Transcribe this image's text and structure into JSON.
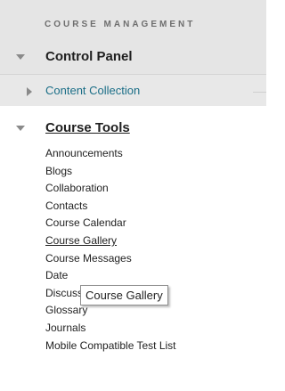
{
  "section_heading": "COURSE MANAGEMENT",
  "control_panel": {
    "title": "Control Panel",
    "content_collection": "Content Collection"
  },
  "course_tools": {
    "title": "Course Tools",
    "items": [
      "Announcements",
      "Blogs",
      "Collaboration",
      "Contacts",
      "Course Calendar",
      "Course Gallery",
      "Course Messages",
      "Date",
      "Discussion Board",
      "Glossary",
      "Journals",
      "Mobile Compatible Test List"
    ],
    "hovered_item": "Course Gallery"
  },
  "tooltip": "Course Gallery",
  "icons": {
    "expanded": "triangle-down-icon",
    "collapsed": "triangle-right-icon"
  },
  "colors": {
    "panel_bg": "#e5e5e5",
    "link": "#1b6e87",
    "heading": "#6e6e6e"
  }
}
